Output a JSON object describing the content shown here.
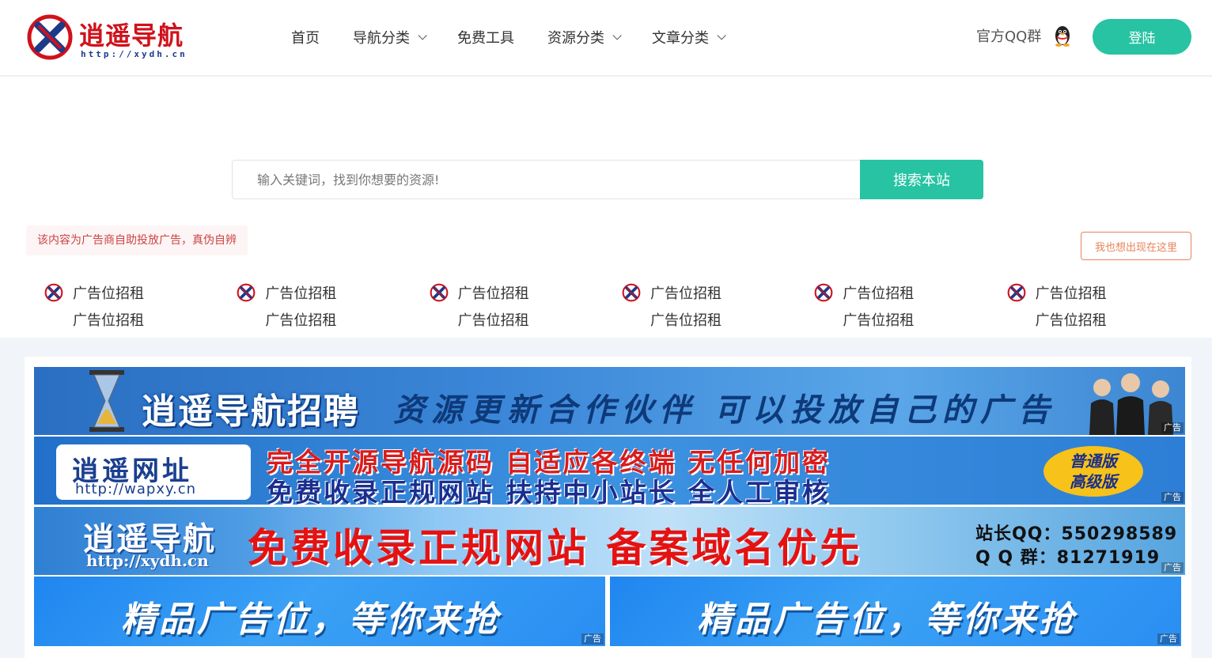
{
  "header": {
    "logo_text": "逍遥导航",
    "logo_url": "http://xydh.cn",
    "nav": [
      {
        "label": "首页",
        "dropdown": false
      },
      {
        "label": "导航分类",
        "dropdown": true
      },
      {
        "label": "免费工具",
        "dropdown": false
      },
      {
        "label": "资源分类",
        "dropdown": true
      },
      {
        "label": "文章分类",
        "dropdown": true
      }
    ],
    "qq_group_label": "官方QQ群",
    "login_label": "登陆",
    "accent_color": "#27c3a3",
    "brand_color": "#d0111b"
  },
  "search": {
    "placeholder": "输入关键词，找到你想要的资源!",
    "button_label": "搜索本站"
  },
  "ads": {
    "notice": "该内容为广告商自助投放广告，真伪自辨",
    "apply_label": "我也想出现在这里",
    "links": [
      {
        "title": "广告位招租",
        "subtitle": "广告位招租"
      },
      {
        "title": "广告位招租",
        "subtitle": "广告位招租"
      },
      {
        "title": "广告位招租",
        "subtitle": "广告位招租"
      },
      {
        "title": "广告位招租",
        "subtitle": "广告位招租"
      },
      {
        "title": "广告位招租",
        "subtitle": "广告位招租"
      },
      {
        "title": "广告位招租",
        "subtitle": "广告位招租"
      }
    ]
  },
  "banners": {
    "tag": "广告",
    "b1": {
      "title": "逍遥导航招聘",
      "sub": "资源更新合作伙伴 可以投放自己的广告"
    },
    "b2": {
      "box_title": "逍遥网址",
      "box_url": "http://wapxy.cn",
      "line1": "完全开源导航源码 自适应各终端 无任何加密",
      "line2": "免费收录正规网站 扶持中小站长 全人工审核",
      "badge1": "普通版",
      "badge2": "高级版"
    },
    "b3": {
      "logo": "逍遥导航",
      "url": "http://xydh.cn",
      "slogan": "免费收录正规网站 备案域名优先",
      "contact1": "站长QQ：550298589",
      "contact2": "Q Q 群：81271919"
    },
    "b4": {
      "text": "精品广告位，等你来抢"
    }
  }
}
